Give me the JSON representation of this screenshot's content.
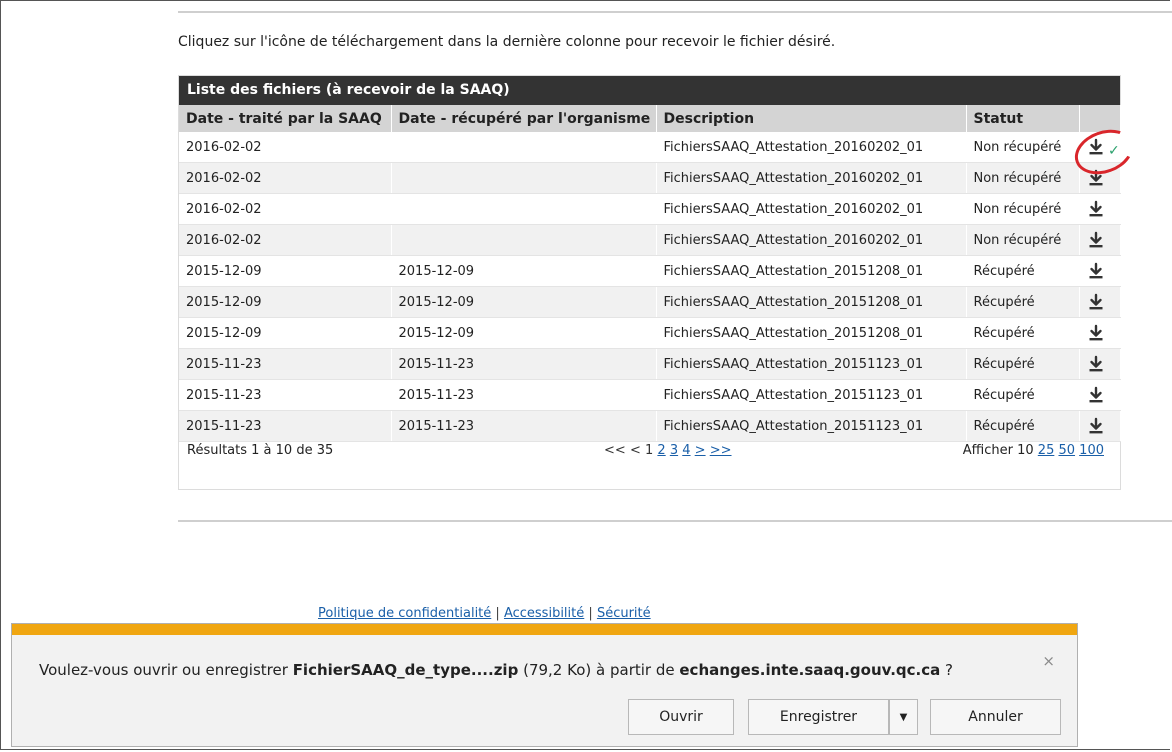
{
  "instructions": "Cliquez sur l'icône de téléchargement dans la dernière colonne pour recevoir le fichier désiré.",
  "table": {
    "title": "Liste des fichiers (à recevoir de la SAAQ)",
    "headers": [
      "Date - traité par la SAAQ",
      "Date - récupéré par l'organisme",
      "Description",
      "Statut"
    ],
    "rows": [
      [
        "2016-02-02",
        "",
        "FichiersSAAQ_Attestation_20160202_01",
        "Non récupéré"
      ],
      [
        "2016-02-02",
        "",
        "FichiersSAAQ_Attestation_20160202_01",
        "Non récupéré"
      ],
      [
        "2016-02-02",
        "",
        "FichiersSAAQ_Attestation_20160202_01",
        "Non récupéré"
      ],
      [
        "2016-02-02",
        "",
        "FichiersSAAQ_Attestation_20160202_01",
        "Non récupéré"
      ],
      [
        "2015-12-09",
        "2015-12-09",
        "FichiersSAAQ_Attestation_20151208_01",
        "Récupéré"
      ],
      [
        "2015-12-09",
        "2015-12-09",
        "FichiersSAAQ_Attestation_20151208_01",
        "Récupéré"
      ],
      [
        "2015-12-09",
        "2015-12-09",
        "FichiersSAAQ_Attestation_20151208_01",
        "Récupéré"
      ],
      [
        "2015-11-23",
        "2015-11-23",
        "FichiersSAAQ_Attestation_20151123_01",
        "Récupéré"
      ],
      [
        "2015-11-23",
        "2015-11-23",
        "FichiersSAAQ_Attestation_20151123_01",
        "Récupéré"
      ],
      [
        "2015-11-23",
        "2015-11-23",
        "FichiersSAAQ_Attestation_20151123_01",
        "Récupéré"
      ]
    ],
    "download_icon": "download-icon"
  },
  "pager": {
    "results": "Résultats 1 à 10 de 35",
    "first": "<<",
    "prev": "<",
    "current": "1",
    "pages": [
      "2",
      "3",
      "4"
    ],
    "next": ">",
    "last": ">>",
    "show_label": "Afficher",
    "show_current": "10",
    "show_options": [
      "25",
      "50",
      "100"
    ]
  },
  "footer": {
    "privacy": "Politique de confidentialité",
    "accessibility": "Accessibilité",
    "security": "Sécurité",
    "separator": "|"
  },
  "download_bar": {
    "prefix": "Voulez-vous ouvrir ou enregistrer",
    "filename": "FichierSAAQ_de_type....zip",
    "size": "(79,2 Ko)",
    "from": "à partir de",
    "host": "echanges.inte.saaq.gouv.qc.ca",
    "suffix": "?",
    "close": "×",
    "open_label": "Ouvrir",
    "save_label": "Enregistrer",
    "save_arrow": "▼",
    "cancel_label": "Annuler",
    "accent_color": "#f0a611"
  },
  "colors": {
    "header_bar": "#333333",
    "link": "#1a5fa8",
    "highlight_circle": "#d9262b"
  }
}
